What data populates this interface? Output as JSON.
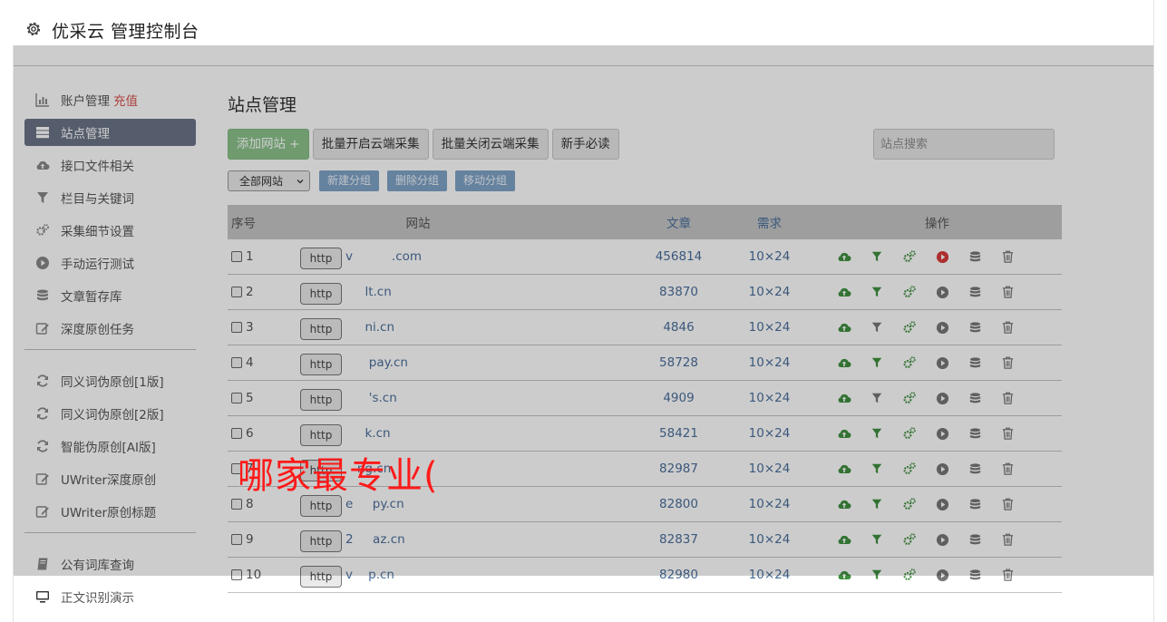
{
  "header": {
    "title": "优采云 管理控制台"
  },
  "sidebar": {
    "group1": [
      {
        "label": "账户管理",
        "badge": "充值",
        "icon": "bar-chart-icon"
      },
      {
        "label": "站点管理",
        "icon": "server-icon",
        "active": true
      },
      {
        "label": "接口文件相关",
        "icon": "cloud-upload-icon"
      },
      {
        "label": "栏目与关键词",
        "icon": "filter-icon"
      },
      {
        "label": "采集细节设置",
        "icon": "gears-icon"
      },
      {
        "label": "手动运行测试",
        "icon": "play-circle-icon"
      },
      {
        "label": "文章暂存库",
        "icon": "database-icon"
      },
      {
        "label": "深度原创任务",
        "icon": "edit-icon"
      }
    ],
    "group2": [
      {
        "label": "同义词伪原创[1版]",
        "icon": "refresh-icon"
      },
      {
        "label": "同义词伪原创[2版]",
        "icon": "refresh-icon"
      },
      {
        "label": "智能伪原创[AI版]",
        "icon": "refresh-icon"
      },
      {
        "label": "UWriter深度原创",
        "icon": "edit-icon"
      },
      {
        "label": "UWriter原创标题",
        "icon": "edit-icon"
      }
    ],
    "group3": [
      {
        "label": "公有词库查询",
        "icon": "book-icon"
      },
      {
        "label": "正文识别演示",
        "icon": "monitor-icon"
      }
    ]
  },
  "main": {
    "title": "站点管理",
    "toolbar": {
      "add": "添加网站 +",
      "enable_cloud": "批量开启云端采集",
      "disable_cloud": "批量关闭云端采集",
      "guide": "新手必读",
      "search_placeholder": "站点搜索"
    },
    "filter": {
      "select_value": "全部网站",
      "new_group": "新建分组",
      "delete_group": "删除分组",
      "move_group": "移动分组"
    },
    "table": {
      "headers": {
        "no": "序号",
        "site": "网站",
        "articles": "文章",
        "demand": "需求",
        "ops": "操作"
      },
      "rows": [
        {
          "no": "1",
          "proto": "http",
          "domain": "v          .com",
          "articles": "456814",
          "demand": "10×24",
          "filter_active": true,
          "play_active": true
        },
        {
          "no": "2",
          "proto": "http",
          "domain": "     lt.cn",
          "articles": "83870",
          "demand": "10×24",
          "filter_active": true,
          "play_active": false
        },
        {
          "no": "3",
          "proto": "http",
          "domain": "     ni.cn",
          "articles": "4846",
          "demand": "10×24",
          "filter_active": false,
          "play_active": false
        },
        {
          "no": "4",
          "proto": "http",
          "domain": "      pay.cn",
          "articles": "58728",
          "demand": "10×24",
          "filter_active": true,
          "play_active": false
        },
        {
          "no": "5",
          "proto": "http",
          "domain": "      's.cn",
          "articles": "4909",
          "demand": "10×24",
          "filter_active": false,
          "play_active": false
        },
        {
          "no": "6",
          "proto": "http",
          "domain": "     k.cn",
          "articles": "58421",
          "demand": "10×24",
          "filter_active": true,
          "play_active": false
        },
        {
          "no": "7",
          "proto": "http",
          "domain": "   ng.cn",
          "articles": "82987",
          "demand": "10×24",
          "filter_active": true,
          "play_active": false
        },
        {
          "no": "8",
          "proto": "http",
          "domain": "e     py.cn",
          "articles": "82800",
          "demand": "10×24",
          "filter_active": true,
          "play_active": false
        },
        {
          "no": "9",
          "proto": "http",
          "domain": "2     az.cn",
          "articles": "82837",
          "demand": "10×24",
          "filter_active": true,
          "play_active": false
        },
        {
          "no": "10",
          "proto": "http",
          "domain": "v    p.cn",
          "articles": "82980",
          "demand": "10×24",
          "filter_active": true,
          "play_active": false
        }
      ]
    }
  },
  "overlay": {
    "text": "哪家最专业("
  },
  "colors": {
    "green": "#3f8f3f",
    "red": "#d93a3a",
    "gray": "#777777",
    "link": "#4a6f9b"
  }
}
